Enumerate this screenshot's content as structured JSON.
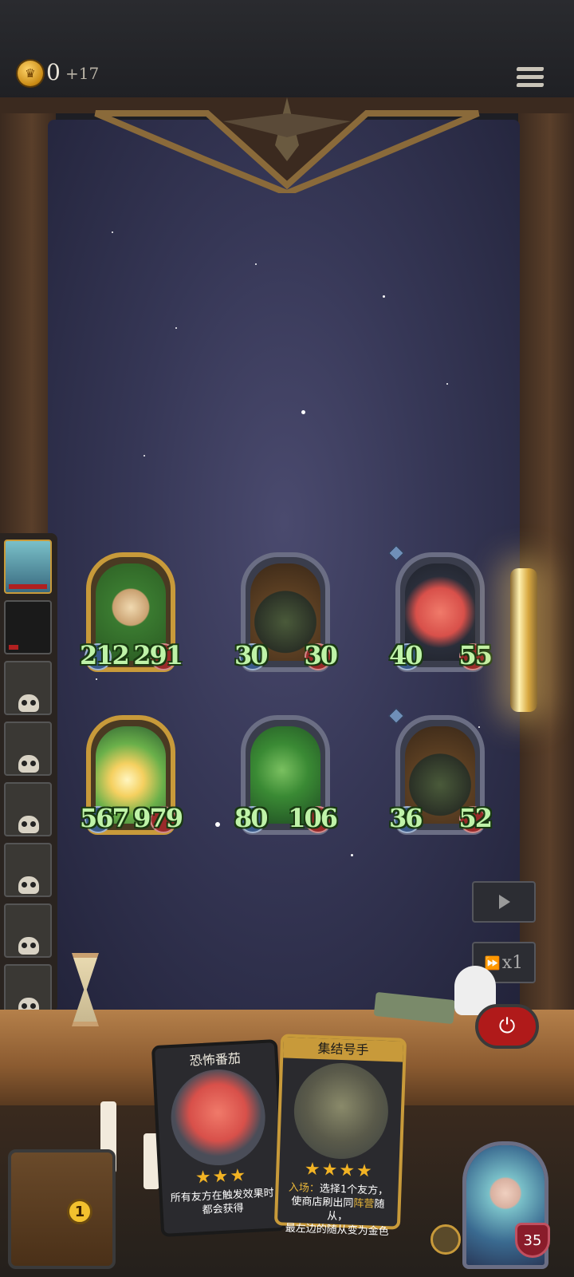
{
  "header": {
    "gold": "0",
    "gold_income": "+17",
    "coin_icon": "crown-coin-icon",
    "menu_icon": "hamburger-menu-icon"
  },
  "board": {
    "row1": [
      {
        "name": "sprout-minion",
        "attack": "212",
        "health": "291",
        "frame": "gold"
      },
      {
        "name": "goblin-wizard-minion",
        "attack": "30",
        "health": "30",
        "frame": "silver"
      },
      {
        "name": "tomato-minion",
        "attack": "40",
        "health": "55",
        "frame": "silver"
      }
    ],
    "row2": [
      {
        "name": "glowing-dragon-minion",
        "attack": "567",
        "health": "979",
        "frame": "gold"
      },
      {
        "name": "leaf-spirit-minion",
        "attack": "80",
        "health": "106",
        "frame": "silver"
      },
      {
        "name": "goblin-wizard-minion",
        "attack": "36",
        "health": "52",
        "frame": "silver"
      }
    ]
  },
  "controls": {
    "play_icon": "play-icon",
    "speed_label": "x1",
    "speed_icon": "fast-forward-icon",
    "power_icon": "power-icon"
  },
  "shop": {
    "card1": {
      "name": "恐怖番茄",
      "stars": "★★★",
      "desc": "所有友方在触发效果时都会获得"
    },
    "card2": {
      "name": "集结号手",
      "stars": "★★★★",
      "desc_keyword": "入场：",
      "desc_line1": "选择1个友方，",
      "desc_line2a": "使商店刷出同",
      "desc_line2_kw": "阵营",
      "desc_line2b": "随从，",
      "desc_line3": "最左边的随从变为金色"
    }
  },
  "tavern": {
    "tier": "1"
  },
  "hero": {
    "health": "35"
  },
  "colors": {
    "stat_text": "#bff3a8",
    "gold_frame": "#c89a3a",
    "silver_frame": "#6b6e84",
    "power_red": "#b01a1a",
    "star_color": "#f2b324"
  }
}
